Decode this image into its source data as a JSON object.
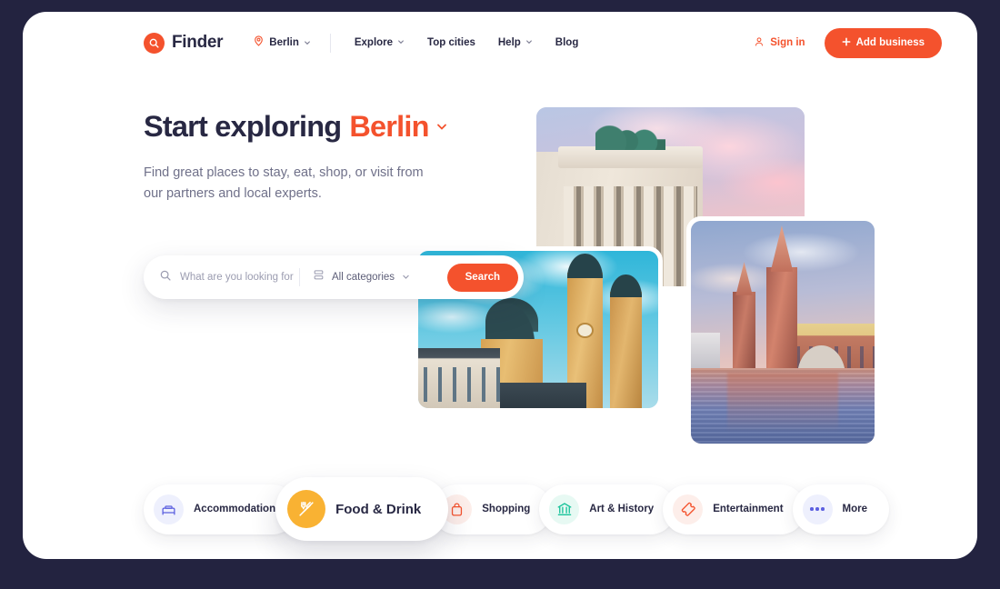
{
  "theme": {
    "page_background": "#232340",
    "card_background": "#ffffff",
    "accent_orange": "#f4522d",
    "text_dark": "#282843",
    "text_muted": "#6f7089"
  },
  "header": {
    "brand": {
      "name": "Finder",
      "icon": "search-circle-logo-icon"
    },
    "city": {
      "label": "Berlin",
      "icon": "location-pin-icon",
      "chevron": "chevron-down-icon"
    },
    "nav": [
      {
        "label": "Explore",
        "has_chevron": true
      },
      {
        "label": "Top cities",
        "has_chevron": false
      },
      {
        "label": "Help",
        "has_chevron": true
      },
      {
        "label": "Blog",
        "has_chevron": false
      }
    ],
    "sign_in": {
      "label": "Sign in",
      "icon": "user-icon"
    },
    "add_business": {
      "label": "Add business",
      "icon": "plus-icon"
    }
  },
  "hero": {
    "title_prefix": "Start exploring",
    "title_city": "Berlin",
    "title_chevron": "chevron-down-icon",
    "subtitle": "Find great places to stay, eat, shop, or visit from our partners and local experts."
  },
  "search": {
    "input_value": "",
    "placeholder": "What are you looking for?",
    "search_icon": "search-icon",
    "category_icon": "layers-icon",
    "category_label": "All categories",
    "category_chevron": "chevron-down-icon",
    "button_label": "Search"
  },
  "photos": [
    {
      "name": "brandenburg-gate",
      "alt": "Brandenburg Gate at sunset"
    },
    {
      "name": "theatinerkirche",
      "alt": "Yellow baroque church with blue sky"
    },
    {
      "name": "oberbaum-bridge",
      "alt": "Oberbaum Bridge reflected in river at sunset"
    }
  ],
  "categories": [
    {
      "id": "accommodation",
      "label": "Accommodation",
      "icon": "bed-icon",
      "icon_color": "#5b5fe0",
      "icon_bg": "#eef0fd",
      "active": false
    },
    {
      "id": "food-drink",
      "label": "Food & Drink",
      "icon": "cutlery-icon",
      "icon_color": "#ffffff",
      "icon_bg": "#f9b233",
      "active": true
    },
    {
      "id": "shopping",
      "label": "Shopping",
      "icon": "shopping-bag-icon",
      "icon_color": "#f4522d",
      "icon_bg": "#fdeeea",
      "active": false
    },
    {
      "id": "art-history",
      "label": "Art & History",
      "icon": "museum-icon",
      "icon_color": "#18c39a",
      "icon_bg": "#e7f9f3",
      "active": false
    },
    {
      "id": "entertainment",
      "label": "Entertainment",
      "icon": "ticket-icon",
      "icon_color": "#f4522d",
      "icon_bg": "#fdeeea",
      "active": false
    },
    {
      "id": "more",
      "label": "More",
      "icon": "ellipsis-icon",
      "icon_color": "#5b5fe0",
      "icon_bg": "#eef0fd",
      "active": false
    }
  ]
}
